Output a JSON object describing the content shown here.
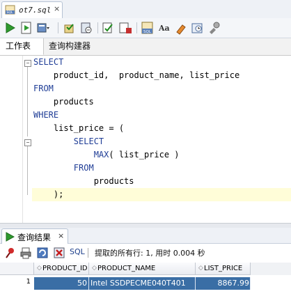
{
  "document_tab": {
    "label": "ot7.sql",
    "close": "×"
  },
  "toolbar": {
    "buttons": [
      "run-statement-icon",
      "run-script-icon",
      "sql-tuning-icon",
      "commit-icon",
      "rollback-icon",
      "autotrace-icon",
      "explain-plan-icon",
      "format-sql-icon",
      "case-icon",
      "clear-icon",
      "history-icon",
      "unshared-sql-icon"
    ]
  },
  "subtabs": {
    "worksheet": "工作表",
    "query_builder": "查询构建器"
  },
  "editor": {
    "lines": [
      {
        "kw": "SELECT",
        "text": ""
      },
      {
        "kw": "",
        "text": "    product_id,  product_name, list_price"
      },
      {
        "kw": "FROM",
        "text": ""
      },
      {
        "kw": "",
        "text": "    products"
      },
      {
        "kw": "WHERE",
        "text": ""
      },
      {
        "kw": "",
        "text": "    list_price = ("
      },
      {
        "kw": "        SELECT",
        "text": ""
      },
      {
        "kw": "            MAX",
        "text": "( list_price )"
      },
      {
        "kw": "        FROM",
        "text": ""
      },
      {
        "kw": "",
        "text": "            products"
      },
      {
        "kw": "",
        "text": "    );"
      }
    ]
  },
  "results": {
    "tab_label": "查询结果",
    "tab_close": "×",
    "sql_label": "SQL",
    "status": "提取的所有行: 1, 用时 0.004 秒",
    "columns": [
      "PRODUCT_ID",
      "PRODUCT_NAME",
      "LIST_PRICE"
    ],
    "rows": [
      {
        "num": "1",
        "product_id": "50",
        "product_name": "Intel SSDPECME040T401",
        "list_price": "8867.99"
      }
    ]
  },
  "colors": {
    "keyword": "#1f3d96",
    "selection": "#3a6ea5",
    "current_line": "#fffdd8"
  }
}
